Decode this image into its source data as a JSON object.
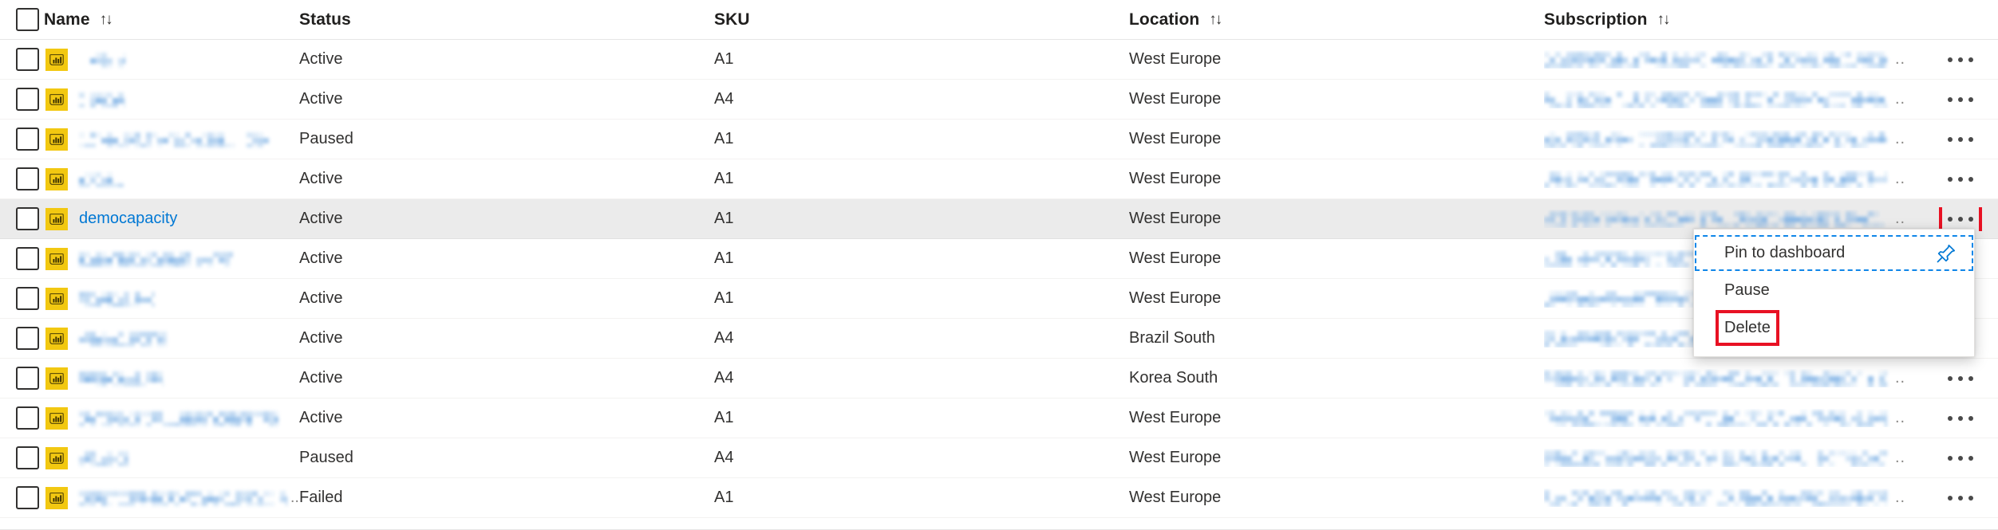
{
  "table": {
    "columns": [
      {
        "key": "select",
        "label": "",
        "sortable": false
      },
      {
        "key": "name",
        "label": "Name",
        "sortable": true,
        "sort_glyph": "↑↓"
      },
      {
        "key": "status",
        "label": "Status",
        "sortable": false
      },
      {
        "key": "sku",
        "label": "SKU",
        "sortable": false
      },
      {
        "key": "location",
        "label": "Location",
        "sortable": true,
        "sort_glyph": "↑↓"
      },
      {
        "key": "subscription",
        "label": "Subscription",
        "sortable": true,
        "sort_glyph": "↑↓"
      }
    ],
    "row_icon_name": "power-bi-capacity-icon",
    "overflow_label": "…",
    "truncation_marker": "..",
    "rows": [
      {
        "name": "",
        "name_redacted": true,
        "name_width": 58,
        "status": "Active",
        "sku": "A1",
        "location": "West Europe",
        "subscription_redacted": true,
        "selected": false,
        "truncated_name": false
      },
      {
        "name": "",
        "name_redacted": true,
        "name_width": 58,
        "status": "Active",
        "sku": "A4",
        "location": "West Europe",
        "subscription_redacted": true,
        "selected": false,
        "truncated_name": false
      },
      {
        "name": "",
        "name_redacted": true,
        "name_width": 238,
        "status": "Paused",
        "sku": "A1",
        "location": "West Europe",
        "subscription_redacted": true,
        "selected": false,
        "truncated_name": false
      },
      {
        "name": "",
        "name_redacted": true,
        "name_width": 56,
        "status": "Active",
        "sku": "A1",
        "location": "West Europe",
        "subscription_redacted": true,
        "selected": false,
        "truncated_name": false
      },
      {
        "name": "democapacity",
        "name_redacted": false,
        "name_width": 0,
        "status": "Active",
        "sku": "A1",
        "location": "West Europe",
        "subscription_redacted": true,
        "selected": true,
        "truncated_name": false
      },
      {
        "name": "",
        "name_redacted": true,
        "name_width": 193,
        "status": "Active",
        "sku": "A1",
        "location": "West Europe",
        "subscription_redacted": true,
        "selected": false,
        "truncated_name": false
      },
      {
        "name": "",
        "name_redacted": true,
        "name_width": 95,
        "status": "Active",
        "sku": "A1",
        "location": "West Europe",
        "subscription_redacted": true,
        "selected": false,
        "truncated_name": false
      },
      {
        "name": "",
        "name_redacted": true,
        "name_width": 110,
        "status": "Active",
        "sku": "A4",
        "location": "Brazil South",
        "subscription_redacted": true,
        "selected": false,
        "truncated_name": false
      },
      {
        "name": "",
        "name_redacted": true,
        "name_width": 106,
        "status": "Active",
        "sku": "A4",
        "location": "Korea South",
        "subscription_redacted": true,
        "selected": false,
        "truncated_name": false
      },
      {
        "name": "",
        "name_redacted": true,
        "name_width": 250,
        "status": "Active",
        "sku": "A1",
        "location": "West Europe",
        "subscription_redacted": true,
        "selected": false,
        "truncated_name": false
      },
      {
        "name": "",
        "name_redacted": true,
        "name_width": 62,
        "status": "Paused",
        "sku": "A4",
        "location": "West Europe",
        "subscription_redacted": true,
        "selected": false,
        "truncated_name": false
      },
      {
        "name": "",
        "name_redacted": true,
        "name_width": 268,
        "status": "Failed",
        "sku": "A1",
        "location": "West Europe",
        "subscription_redacted": true,
        "selected": false,
        "truncated_name": true
      }
    ]
  },
  "context_menu": {
    "anchor_row_index": 4,
    "items": [
      {
        "label": "Pin to dashboard",
        "icon": "pin-icon",
        "focused": true,
        "annotated": false
      },
      {
        "label": "Pause",
        "icon": "",
        "focused": false,
        "annotated": false
      },
      {
        "label": "Delete",
        "icon": "",
        "focused": false,
        "annotated": true
      }
    ]
  },
  "annotations": {
    "highlight_color": "#e81123",
    "focus_color": "#0f86e8",
    "targets": [
      "overflow-menu-button",
      "menu-item-delete"
    ]
  },
  "colors": {
    "link": "#0078d4",
    "icon_background": "#f2c811",
    "selected_row": "#ebebeb",
    "row_divider": "#f3f2f1",
    "text": "#323130"
  }
}
